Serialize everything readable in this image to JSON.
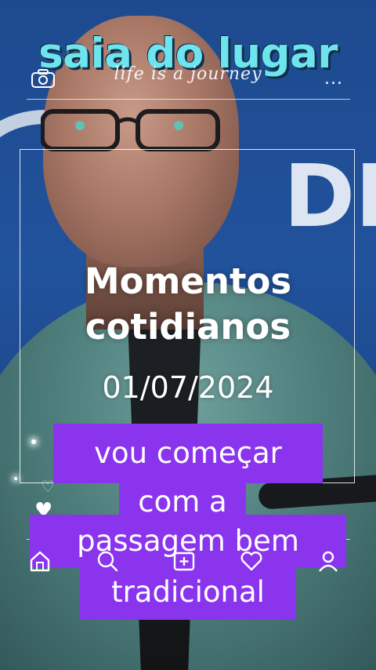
{
  "overlay": {
    "title": "saia do lugar",
    "script_text": "life is a journey",
    "more_label": "..."
  },
  "card": {
    "title_line1": "Momentos",
    "title_line2": "cotidianos",
    "date": "01/07/2024"
  },
  "caption": {
    "line1": "vou começar",
    "line2": "com a",
    "line3": "passagem bem",
    "line4": "tradicional"
  },
  "background": {
    "sign_letters": "DI"
  },
  "icons": {
    "top_left": "camera-icon",
    "top_right": "more-options-icon",
    "nav": [
      "home-icon",
      "search-icon",
      "add-photo-icon",
      "heart-icon",
      "profile-icon"
    ],
    "decor": [
      "heart-icon",
      "sparkle-icon"
    ]
  },
  "colors": {
    "title": "#6ee4ef",
    "caption_bg": "#8a34ee",
    "background": "#21529c"
  }
}
